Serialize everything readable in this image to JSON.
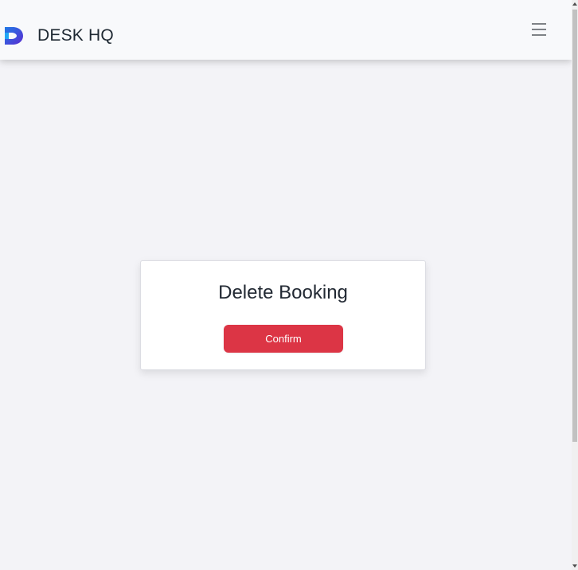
{
  "navbar": {
    "brand_name": "DESK HQ",
    "logo_icon": "desk-hq-logo-icon",
    "menu_icon": "hamburger-menu-icon"
  },
  "dialog": {
    "title": "Delete Booking",
    "confirm_label": "Confirm"
  },
  "colors": {
    "page_background": "#f3f3f7",
    "navbar_background": "#f8f9fb",
    "confirm_button": "#dc3545",
    "logo_blue": "#1f7ae6",
    "logo_purple": "#5b2bd1"
  }
}
